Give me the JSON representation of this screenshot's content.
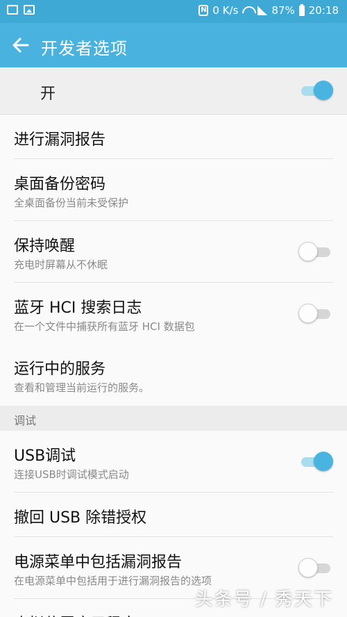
{
  "status_bar": {
    "network_speed": "0 K/s",
    "battery": "87%",
    "time": "20:18",
    "icons": [
      "message-icon",
      "image-icon",
      "nfc-icon",
      "wifi-icon",
      "signal-icon",
      "battery-icon"
    ]
  },
  "app_bar": {
    "title": "开发者选项",
    "back_icon": "arrow-left-icon"
  },
  "master_switch": {
    "label": "开",
    "on": true
  },
  "settings": [
    {
      "title": "进行漏洞报告"
    },
    {
      "title": "桌面备份密码",
      "subtitle": "全桌面备份当前未受保护"
    },
    {
      "title": "保持唤醒",
      "subtitle": "充电时屏幕从不休眠",
      "toggle": false
    },
    {
      "title": "蓝牙 HCI 搜索日志",
      "subtitle": "在一个文件中捕获所有蓝牙 HCI 数据包",
      "toggle": false
    },
    {
      "title": "运行中的服务",
      "subtitle": "查看和管理当前运行的服务。"
    }
  ],
  "debug_section": {
    "header": "调试",
    "items": [
      {
        "title": "USB调试",
        "subtitle": "连接USB时调试模式启动",
        "toggle": true
      },
      {
        "title": "撤回 USB 除错授权"
      },
      {
        "title": "电源菜单中包括漏洞报告",
        "subtitle": "在电源菜单中包括用于进行漏洞报告的选项",
        "toggle": false
      },
      {
        "title": "虚拟位置应用程序"
      }
    ]
  },
  "watermark": "头条号 / 秀天下",
  "colors": {
    "status_bar": "#3fa9d6",
    "app_bar": "#4ab2de",
    "toggle_on": "#4ab4e0"
  }
}
